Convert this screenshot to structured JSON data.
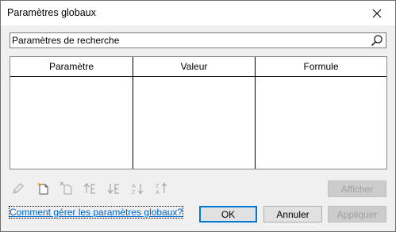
{
  "window": {
    "title": "Paramètres globaux"
  },
  "search": {
    "placeholder": "Paramètres de recherche"
  },
  "table": {
    "columns": [
      "Paramètre",
      "Valeur",
      "Formule"
    ]
  },
  "toolbar": {
    "icons": [
      "edit-pencil-icon",
      "new-parameter-icon",
      "delete-parameter-icon",
      "move-up-icon",
      "move-down-icon",
      "sort-ascending-icon",
      "sort-descending-icon"
    ],
    "show_label": "Afficher"
  },
  "help_link": "Comment gérer les paramètres globaux?",
  "buttons": {
    "ok": "OK",
    "cancel": "Annuler",
    "apply": "Appliquer"
  }
}
